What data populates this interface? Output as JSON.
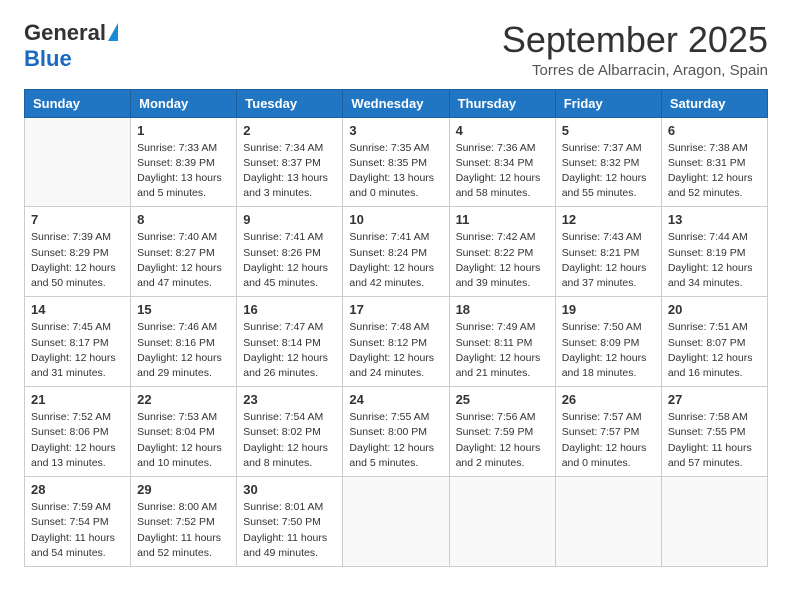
{
  "header": {
    "logo_general": "General",
    "logo_blue": "Blue",
    "month_title": "September 2025",
    "location": "Torres de Albarracin, Aragon, Spain"
  },
  "weekdays": [
    "Sunday",
    "Monday",
    "Tuesday",
    "Wednesday",
    "Thursday",
    "Friday",
    "Saturday"
  ],
  "weeks": [
    [
      {
        "day": "",
        "info": ""
      },
      {
        "day": "1",
        "info": "Sunrise: 7:33 AM\nSunset: 8:39 PM\nDaylight: 13 hours\nand 5 minutes."
      },
      {
        "day": "2",
        "info": "Sunrise: 7:34 AM\nSunset: 8:37 PM\nDaylight: 13 hours\nand 3 minutes."
      },
      {
        "day": "3",
        "info": "Sunrise: 7:35 AM\nSunset: 8:35 PM\nDaylight: 13 hours\nand 0 minutes."
      },
      {
        "day": "4",
        "info": "Sunrise: 7:36 AM\nSunset: 8:34 PM\nDaylight: 12 hours\nand 58 minutes."
      },
      {
        "day": "5",
        "info": "Sunrise: 7:37 AM\nSunset: 8:32 PM\nDaylight: 12 hours\nand 55 minutes."
      },
      {
        "day": "6",
        "info": "Sunrise: 7:38 AM\nSunset: 8:31 PM\nDaylight: 12 hours\nand 52 minutes."
      }
    ],
    [
      {
        "day": "7",
        "info": "Sunrise: 7:39 AM\nSunset: 8:29 PM\nDaylight: 12 hours\nand 50 minutes."
      },
      {
        "day": "8",
        "info": "Sunrise: 7:40 AM\nSunset: 8:27 PM\nDaylight: 12 hours\nand 47 minutes."
      },
      {
        "day": "9",
        "info": "Sunrise: 7:41 AM\nSunset: 8:26 PM\nDaylight: 12 hours\nand 45 minutes."
      },
      {
        "day": "10",
        "info": "Sunrise: 7:41 AM\nSunset: 8:24 PM\nDaylight: 12 hours\nand 42 minutes."
      },
      {
        "day": "11",
        "info": "Sunrise: 7:42 AM\nSunset: 8:22 PM\nDaylight: 12 hours\nand 39 minutes."
      },
      {
        "day": "12",
        "info": "Sunrise: 7:43 AM\nSunset: 8:21 PM\nDaylight: 12 hours\nand 37 minutes."
      },
      {
        "day": "13",
        "info": "Sunrise: 7:44 AM\nSunset: 8:19 PM\nDaylight: 12 hours\nand 34 minutes."
      }
    ],
    [
      {
        "day": "14",
        "info": "Sunrise: 7:45 AM\nSunset: 8:17 PM\nDaylight: 12 hours\nand 31 minutes."
      },
      {
        "day": "15",
        "info": "Sunrise: 7:46 AM\nSunset: 8:16 PM\nDaylight: 12 hours\nand 29 minutes."
      },
      {
        "day": "16",
        "info": "Sunrise: 7:47 AM\nSunset: 8:14 PM\nDaylight: 12 hours\nand 26 minutes."
      },
      {
        "day": "17",
        "info": "Sunrise: 7:48 AM\nSunset: 8:12 PM\nDaylight: 12 hours\nand 24 minutes."
      },
      {
        "day": "18",
        "info": "Sunrise: 7:49 AM\nSunset: 8:11 PM\nDaylight: 12 hours\nand 21 minutes."
      },
      {
        "day": "19",
        "info": "Sunrise: 7:50 AM\nSunset: 8:09 PM\nDaylight: 12 hours\nand 18 minutes."
      },
      {
        "day": "20",
        "info": "Sunrise: 7:51 AM\nSunset: 8:07 PM\nDaylight: 12 hours\nand 16 minutes."
      }
    ],
    [
      {
        "day": "21",
        "info": "Sunrise: 7:52 AM\nSunset: 8:06 PM\nDaylight: 12 hours\nand 13 minutes."
      },
      {
        "day": "22",
        "info": "Sunrise: 7:53 AM\nSunset: 8:04 PM\nDaylight: 12 hours\nand 10 minutes."
      },
      {
        "day": "23",
        "info": "Sunrise: 7:54 AM\nSunset: 8:02 PM\nDaylight: 12 hours\nand 8 minutes."
      },
      {
        "day": "24",
        "info": "Sunrise: 7:55 AM\nSunset: 8:00 PM\nDaylight: 12 hours\nand 5 minutes."
      },
      {
        "day": "25",
        "info": "Sunrise: 7:56 AM\nSunset: 7:59 PM\nDaylight: 12 hours\nand 2 minutes."
      },
      {
        "day": "26",
        "info": "Sunrise: 7:57 AM\nSunset: 7:57 PM\nDaylight: 12 hours\nand 0 minutes."
      },
      {
        "day": "27",
        "info": "Sunrise: 7:58 AM\nSunset: 7:55 PM\nDaylight: 11 hours\nand 57 minutes."
      }
    ],
    [
      {
        "day": "28",
        "info": "Sunrise: 7:59 AM\nSunset: 7:54 PM\nDaylight: 11 hours\nand 54 minutes."
      },
      {
        "day": "29",
        "info": "Sunrise: 8:00 AM\nSunset: 7:52 PM\nDaylight: 11 hours\nand 52 minutes."
      },
      {
        "day": "30",
        "info": "Sunrise: 8:01 AM\nSunset: 7:50 PM\nDaylight: 11 hours\nand 49 minutes."
      },
      {
        "day": "",
        "info": ""
      },
      {
        "day": "",
        "info": ""
      },
      {
        "day": "",
        "info": ""
      },
      {
        "day": "",
        "info": ""
      }
    ]
  ]
}
